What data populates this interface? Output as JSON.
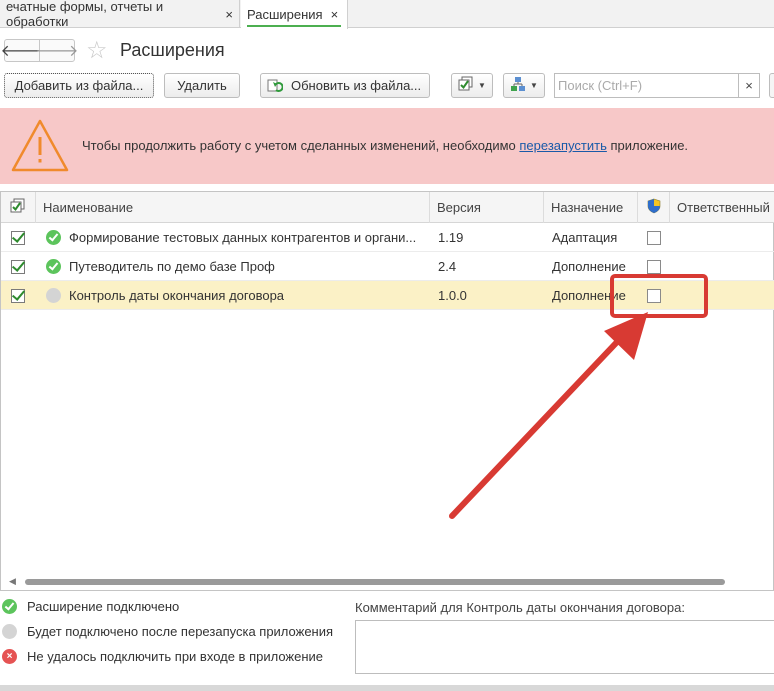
{
  "tabs": [
    {
      "label": "ечатные формы, отчеты и обработки",
      "close": "×",
      "active": false
    },
    {
      "label": "Расширения",
      "close": "×",
      "active": true
    }
  ],
  "header": {
    "back_glyph": "🡐",
    "forward_glyph": "🡒",
    "favorite_glyph": "☆",
    "title": "Расширения"
  },
  "toolbar": {
    "add_label": "Добавить из файла...",
    "delete_label": "Удалить",
    "update_label": "Обновить из файла...",
    "search_placeholder": "Поиск (Ctrl+F)",
    "search_clear": "×",
    "dropdown_glyph": "▼"
  },
  "warning": {
    "text_before": "Чтобы продолжить работу с учетом сделанных изменений, необходимо ",
    "link": "перезапустить",
    "text_after": " приложение."
  },
  "table": {
    "columns": {
      "name": "Наименование",
      "version": "Версия",
      "purpose": "Назначение",
      "responsible": "Ответственный"
    },
    "rows": [
      {
        "name": "Формирование тестовых данных контрагентов и органи...",
        "version": "1.19",
        "purpose": "Адаптация",
        "status": "enabled",
        "active": true,
        "safe_mode": false
      },
      {
        "name": "Путеводитель по демо базе Проф",
        "version": "2.4",
        "purpose": "Дополнение",
        "status": "enabled",
        "active": true,
        "safe_mode": false
      },
      {
        "name": "Контроль даты окончания договора",
        "version": "1.0.0",
        "purpose": "Дополнение",
        "status": "pending",
        "active": true,
        "safe_mode": false
      }
    ]
  },
  "legend": {
    "enabled": "Расширение подключено",
    "pending": "Будет подключено после перезапуска приложения",
    "failed": "Не удалось подключить при входе в приложение",
    "failed_glyph": "×"
  },
  "comment": {
    "label": "Комментарий для Контроль даты окончания договора:"
  },
  "colors": {
    "accent_green": "#4caf50",
    "warning_bg": "#f7c8c8",
    "annotation_red": "#d83a33",
    "selected_row": "#fbf1c6"
  }
}
